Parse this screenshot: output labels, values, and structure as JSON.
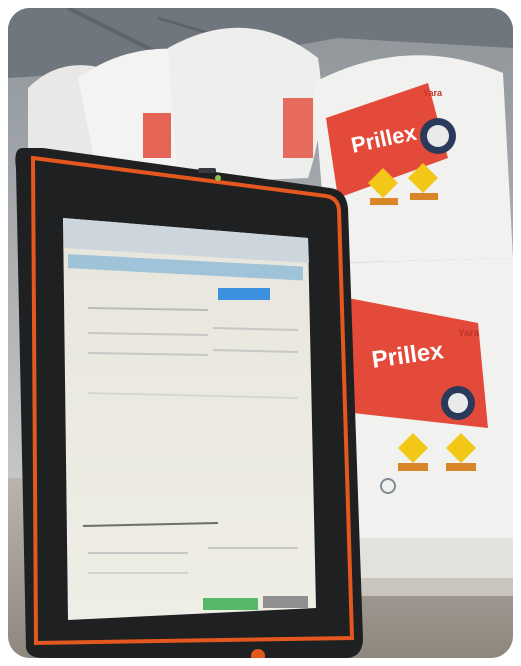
{
  "photo": {
    "bag_top": {
      "logo_text": "Yara",
      "brand": "Prillex"
    },
    "bag_bottom": {
      "logo_text": "Yara",
      "brand": "Prillex"
    },
    "tablet": {
      "screen_button_color": "#3d8fe0",
      "screen_action_color": "#57b86a"
    }
  },
  "colors": {
    "bag_red": "#e34a3a",
    "bag_white": "#f1f1ef",
    "tablet_body": "#1f2022",
    "tablet_accent": "#e4571e",
    "hazard_yellow": "#f2c718"
  }
}
